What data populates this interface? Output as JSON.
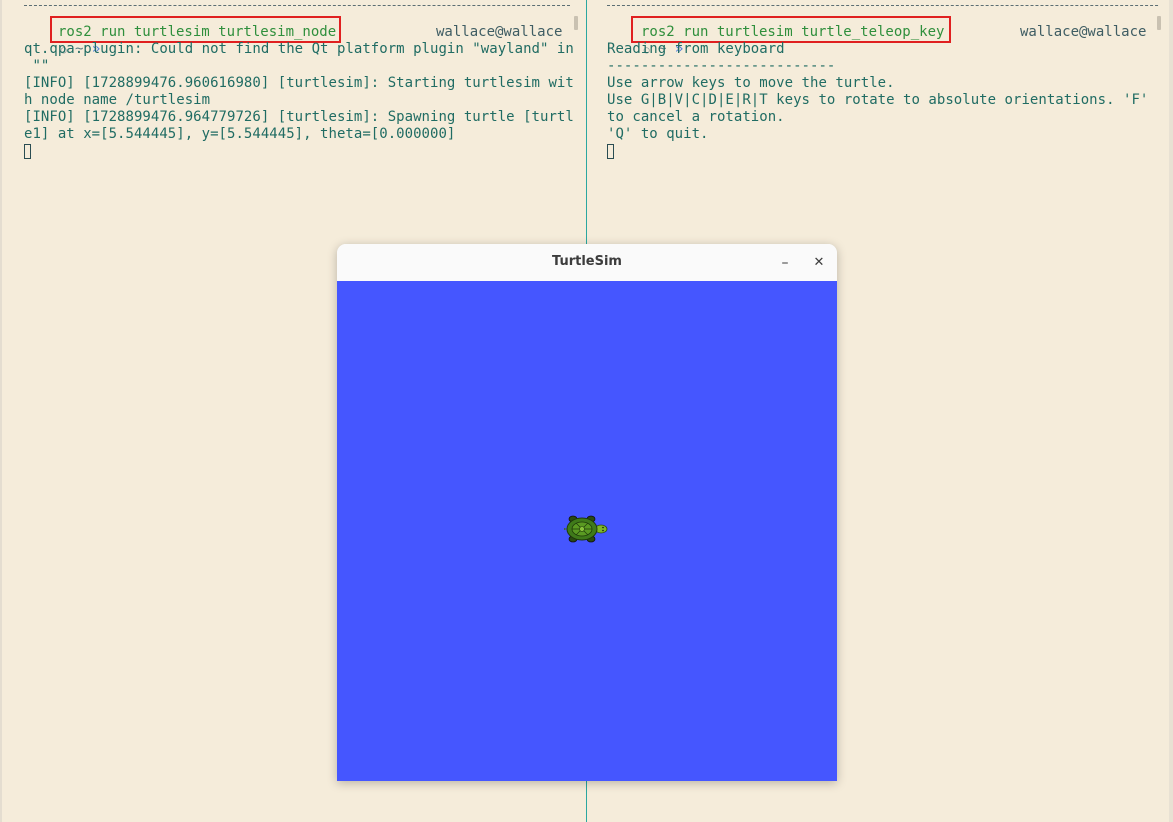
{
  "left_terminal": {
    "prompt_circle": "○",
    "prompt_tilde": "~",
    "prompt_chevron": "»",
    "command": "ros2 run turtlesim turtlesim_node",
    "user_host": "wallace@wallace",
    "output_lines": [
      "qt.qpa.plugin: Could not find the Qt platform plugin \"wayland\" in",
      " \"\"",
      "[INFO] [1728899476.960616980] [turtlesim]: Starting turtlesim wit",
      "h node name /turtlesim",
      "[INFO] [1728899476.964779726] [turtlesim]: Spawning turtle [turtl",
      "e1] at x=[5.544445], y=[5.544445], theta=[0.000000]"
    ]
  },
  "right_terminal": {
    "prompt_circle": "○",
    "prompt_tilde": "~",
    "prompt_chevron": "»",
    "command": "ros2 run turtlesim turtle_teleop_key",
    "user_host": "wallace@wallace",
    "output_lines": [
      "Reading from keyboard",
      "---------------------------",
      "Use arrow keys to move the turtle.",
      "Use G|B|V|C|D|E|R|T keys to rotate to absolute orientations. 'F'",
      "to cancel a rotation.",
      "'Q' to quit."
    ]
  },
  "turtlesim_window": {
    "title": "TurtleSim",
    "minimize_glyph": "–",
    "close_glyph": "✕",
    "background_color": "#4556ff"
  },
  "colors": {
    "terminal_bg": "#f5ecda",
    "terminal_text": "#206c63",
    "command_text": "#2f8f3c",
    "highlight_box": "#e02020",
    "divider": "#2aa7a0"
  }
}
